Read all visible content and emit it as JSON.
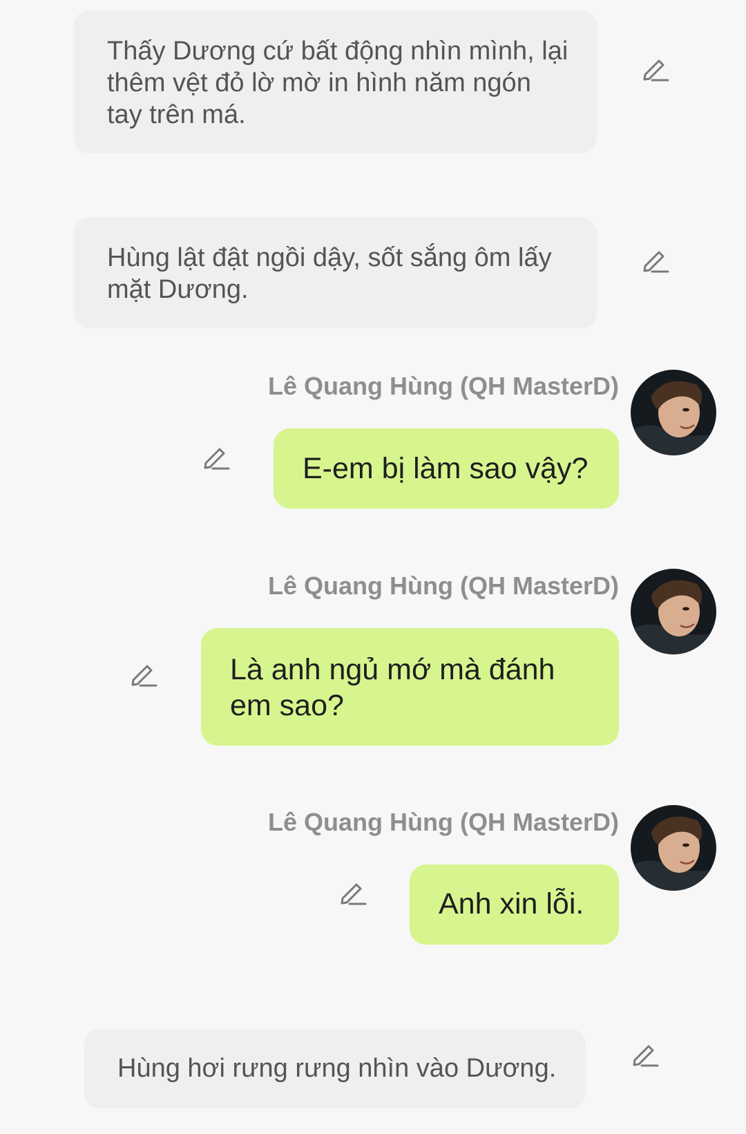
{
  "story": {
    "character_name": "Lê Quang Hùng (QH MasterD)",
    "items": [
      {
        "kind": "narration",
        "text": "Thấy Dương cứ bất động nhìn mình, lại thêm vệt đỏ lờ mờ in hình năm ngón tay trên má."
      },
      {
        "kind": "narration",
        "text": "Hùng lật đật ngồi dậy, sốt sắng ôm lấy mặt Dương."
      },
      {
        "kind": "message",
        "text": "E-em bị làm sao vậy?"
      },
      {
        "kind": "message",
        "text": "Là anh ngủ mớ mà đánh em sao?"
      },
      {
        "kind": "message",
        "text": "Anh xin lỗi."
      },
      {
        "kind": "narration",
        "text": "Hùng hơi rưng rưng nhìn vào Dương."
      }
    ]
  },
  "icons": {
    "edit": "pencil-edit-icon",
    "avatar": "character-avatar"
  },
  "colors": {
    "background": "#f7f7f7",
    "narration_bg": "#efefef",
    "narration_text": "#545454",
    "message_bg": "#d7f58e",
    "message_text": "#1f1f1f",
    "sender_text": "#8e8e8e"
  }
}
